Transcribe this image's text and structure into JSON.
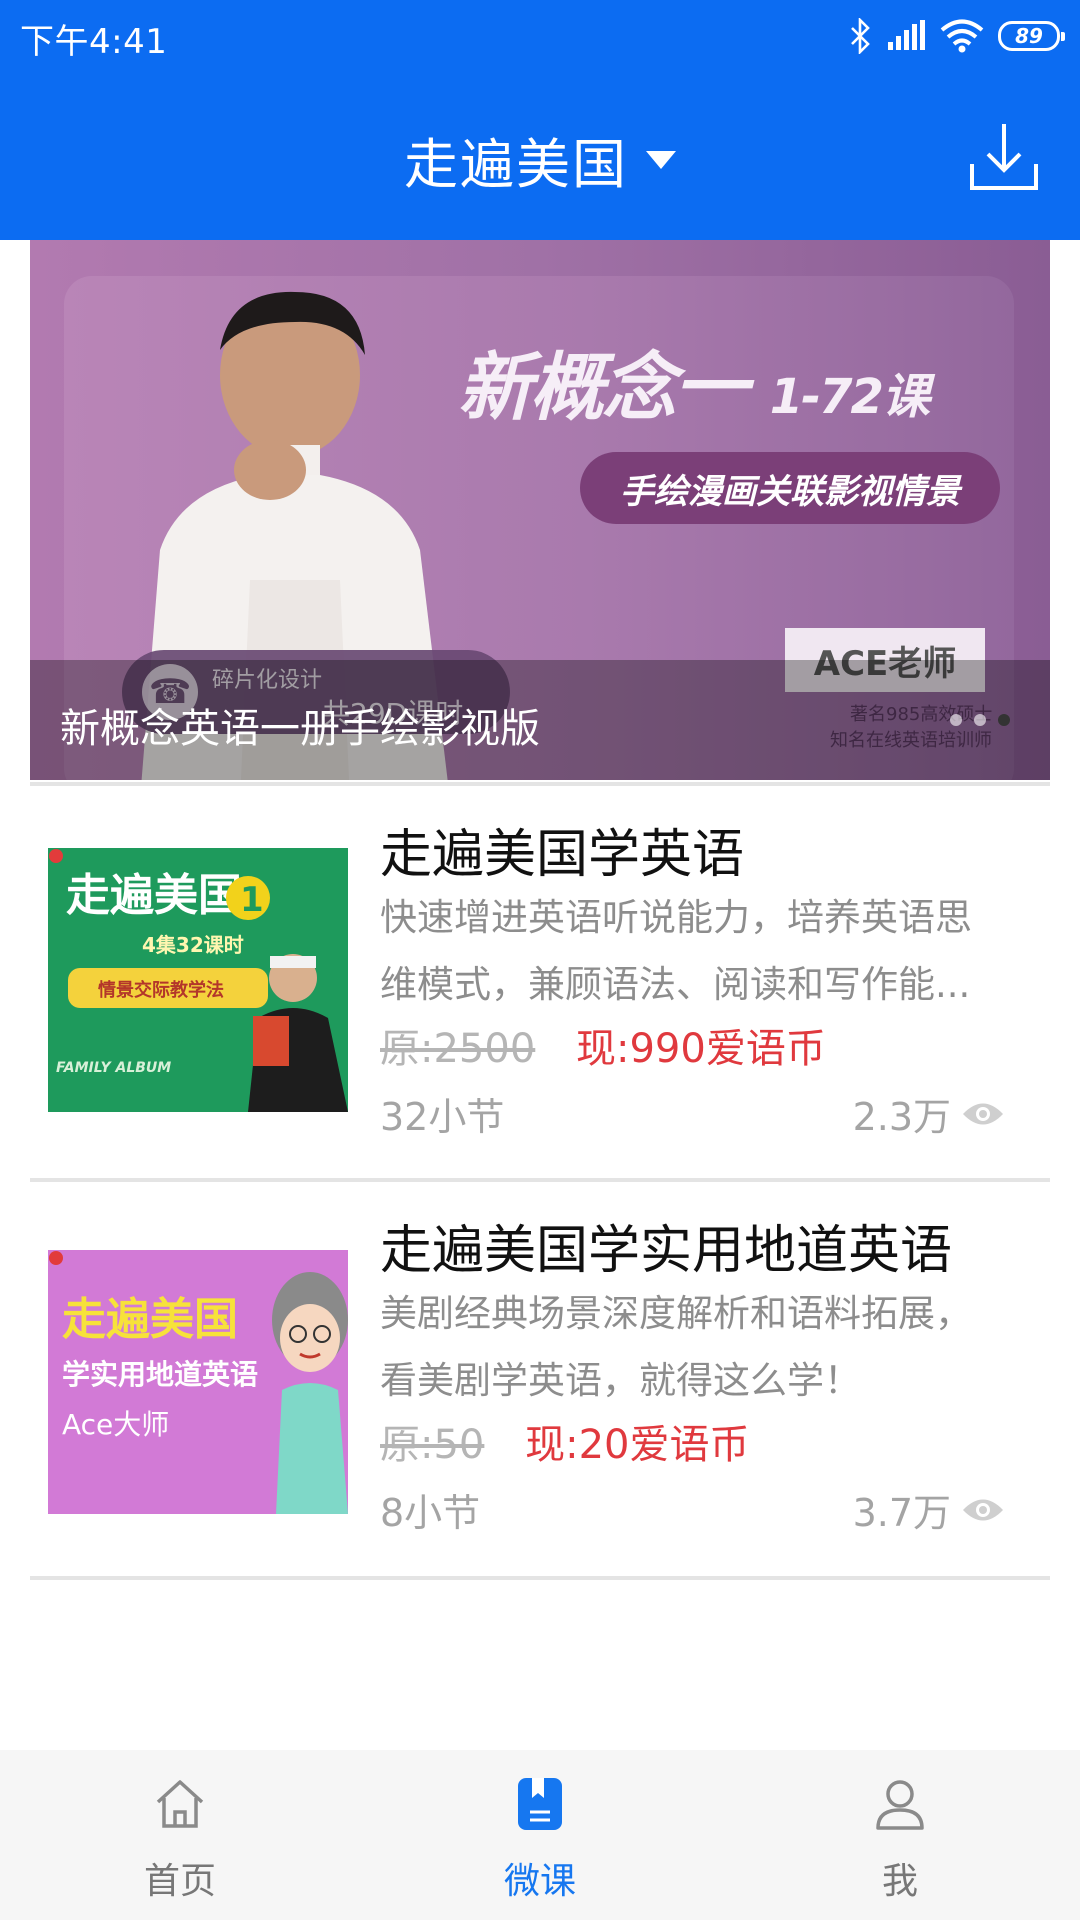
{
  "status_bar": {
    "time": "下午4:41",
    "battery": "89",
    "icons": [
      "bluetooth-icon",
      "signal-icon",
      "wifi-icon",
      "battery-icon"
    ]
  },
  "header": {
    "title": "走遍美国",
    "download_icon": "download-icon",
    "background": "#0c6cf2"
  },
  "banner": {
    "headline": "新概念一",
    "headline_sub": "1-72课",
    "pill": "手绘漫画关联影视情景",
    "chip_line1": "碎片化设计",
    "chip_line2": "共29D课时",
    "teacher_label": "ACE老师",
    "teacher_sub1": "著名985高效硕士",
    "teacher_sub2": "知名在线英语培训师",
    "caption": "新概念英语一册手绘影视版",
    "active_slide": 3,
    "slide_count": 3
  },
  "courses": [
    {
      "title": "走遍美国学英语",
      "desc_line1": "快速增进英语听说能力，培养英语思",
      "desc_line2": "维模式，兼顾语法、阅读和写作能...",
      "price_orig": "原:2500",
      "price_now": "现:990爱语币",
      "lessons": "32小节",
      "views": "2.3万",
      "thumb": {
        "title": "走遍美国",
        "badge": "1",
        "subtitle": "4集32课时",
        "tag": "情景交际教学法",
        "footer": "FAMILY ALBUM"
      }
    },
    {
      "title": "走遍美国学实用地道英语",
      "desc_line1": "美剧经典场景深度解析和语料拓展，",
      "desc_line2": "看美剧学英语，就得这么学！",
      "price_orig": "原:50",
      "price_now": "现:20爱语币",
      "lessons": "8小节",
      "views": "3.7万",
      "thumb": {
        "title": "走遍美国",
        "subtitle": "学实用地道英语",
        "author": "Ace大师"
      }
    }
  ],
  "bottom_nav": [
    {
      "label": "首页",
      "icon": "home-icon",
      "active": false
    },
    {
      "label": "微课",
      "icon": "book-icon",
      "active": true
    },
    {
      "label": "我",
      "icon": "user-icon",
      "active": false
    }
  ],
  "colors": {
    "accent": "#1677f0",
    "price": "#e0393e"
  }
}
